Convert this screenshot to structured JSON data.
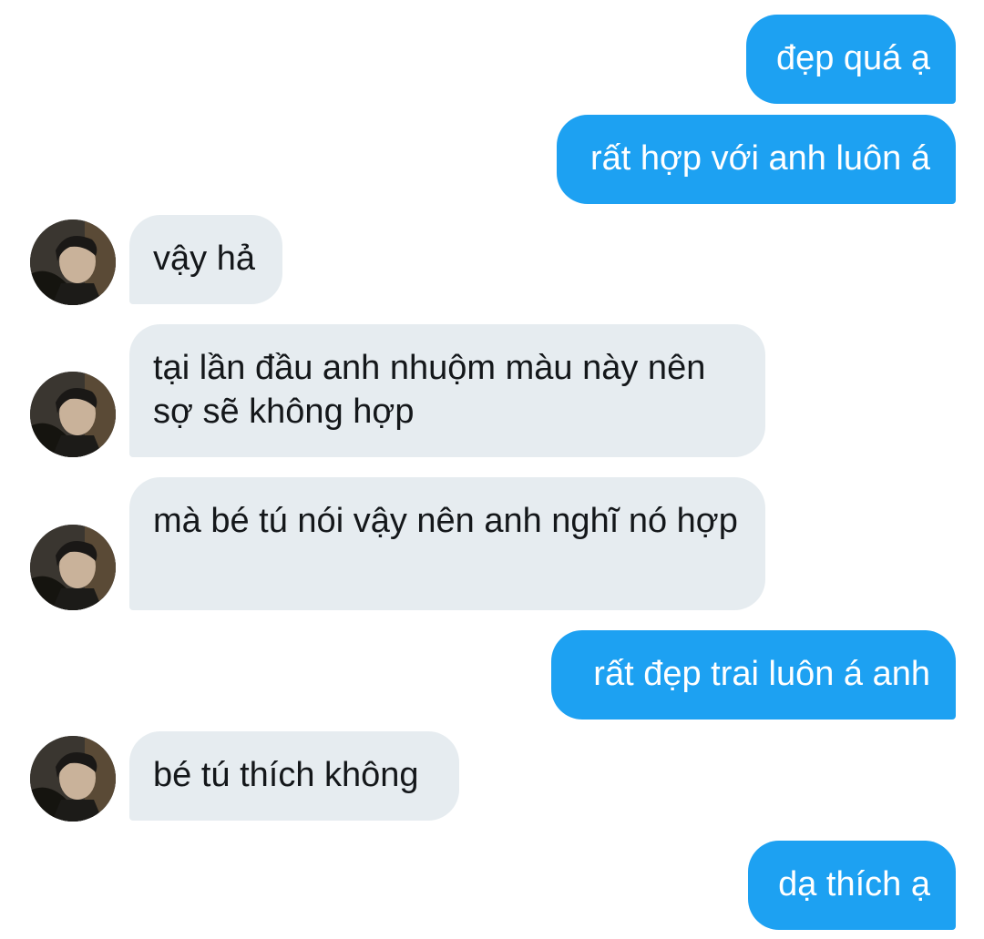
{
  "conversation": {
    "messages": [
      {
        "from": "me",
        "text": "đẹp quá ạ"
      },
      {
        "from": "me",
        "text": "rất hợp với anh luôn á"
      },
      {
        "from": "other",
        "text": "vậy hả"
      },
      {
        "from": "other",
        "text": "tại lần đầu anh nhuộm màu này nên sợ sẽ không hợp"
      },
      {
        "from": "other",
        "text": "mà bé tú nói vậy nên anh nghĩ nó hợp"
      },
      {
        "from": "me",
        "text": "rất đẹp trai luôn á anh"
      },
      {
        "from": "other",
        "text": "bé tú thích không"
      },
      {
        "from": "me",
        "text": "dạ thích ạ"
      }
    ]
  },
  "colors": {
    "sent_bubble": "#1da1f2",
    "received_bubble": "#e6ecf0",
    "sent_text": "#ffffff",
    "received_text": "#14171a",
    "background": "#ffffff"
  },
  "icons": {
    "avatar": "profile-photo-avatar"
  }
}
